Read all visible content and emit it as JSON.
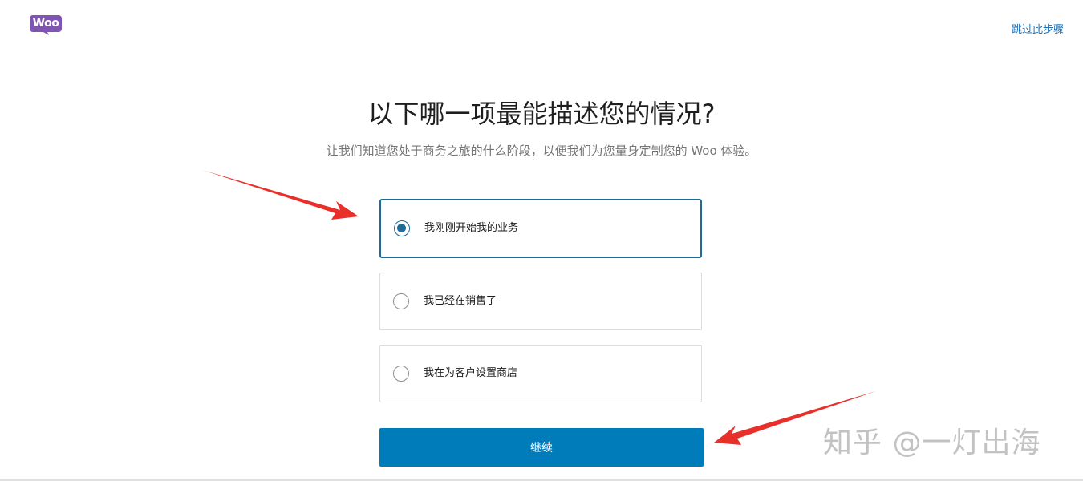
{
  "header": {
    "logo_text": "Woo",
    "skip_link": "跳过此步骤"
  },
  "main": {
    "title": "以下哪一项最能描述您的情况?",
    "subtitle": "让我们知道您处于商务之旅的什么阶段，以便我们为您量身定制您的 Woo 体验。",
    "options": [
      {
        "label": "我刚刚开始我的业务",
        "selected": true
      },
      {
        "label": "我已经在销售了",
        "selected": false
      },
      {
        "label": "我在为客户设置商店",
        "selected": false
      }
    ],
    "continue_label": "继续"
  },
  "watermark": "知乎 @一灯出海",
  "colors": {
    "brand_purple": "#7f54b3",
    "accent_blue": "#007cba",
    "selected_border": "#1e6c98",
    "arrow_red": "#e8302b"
  }
}
